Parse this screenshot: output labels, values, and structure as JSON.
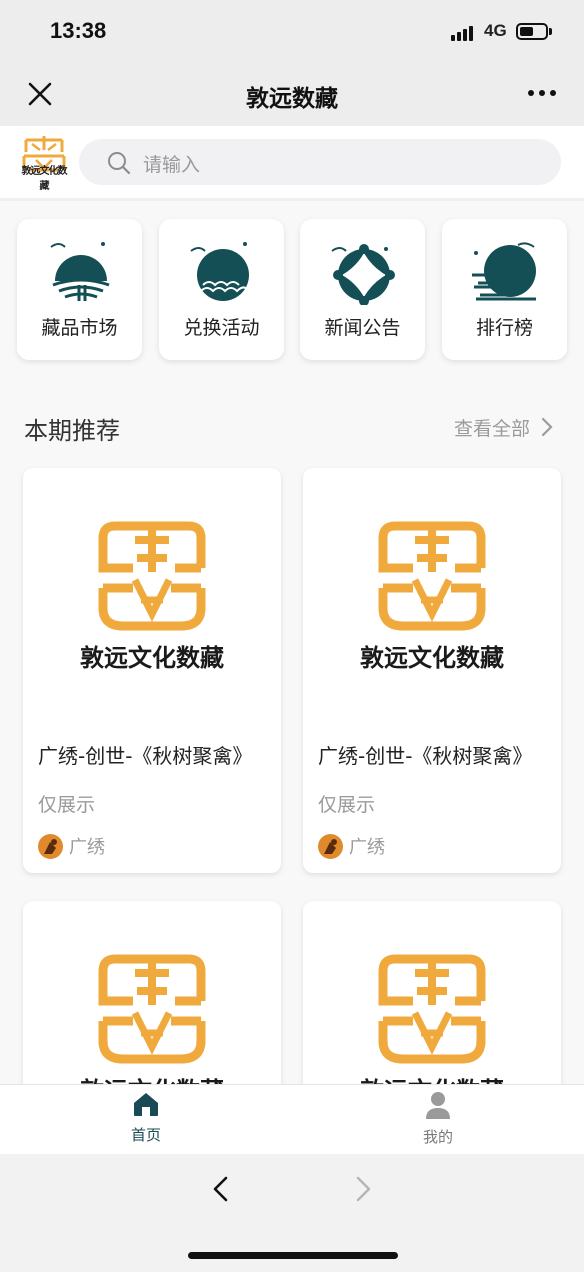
{
  "status": {
    "time": "13:38",
    "network": "4G",
    "battery_level": 0.55
  },
  "nav": {
    "title": "敦远数藏",
    "close_icon": "close-icon",
    "more_icon": "more-icon"
  },
  "brand": {
    "logo_text": "敦远文化数藏"
  },
  "search": {
    "placeholder": "请输入",
    "value": ""
  },
  "categories": [
    {
      "label": "藏品市场",
      "icon": "market-icon"
    },
    {
      "label": "兑换活动",
      "icon": "exchange-icon"
    },
    {
      "label": "新闻公告",
      "icon": "news-icon"
    },
    {
      "label": "排行榜",
      "icon": "ranking-icon"
    }
  ],
  "section": {
    "title": "本期推荐",
    "more_label": "查看全部"
  },
  "products": [
    {
      "name": "广绣-创世-《秋树聚禽》",
      "tag": "仅展示",
      "author": "广绣",
      "cover_text": "敦远文化数藏"
    },
    {
      "name": "广绣-创世-《秋树聚禽》",
      "tag": "仅展示",
      "author": "广绣",
      "cover_text": "敦远文化数藏"
    },
    {
      "name": "",
      "tag": "",
      "author": "",
      "cover_text": "敦远文化数藏"
    },
    {
      "name": "",
      "tag": "",
      "author": "",
      "cover_text": "敦远文化数藏"
    }
  ],
  "tabs": [
    {
      "label": "首页",
      "active": true
    },
    {
      "label": "我的",
      "active": false
    }
  ],
  "colors": {
    "brand_teal": "#134f55",
    "logo_orange": "#f0a93c",
    "tab_active": "#1b4a57",
    "tab_inactive": "#7a7a7a"
  }
}
